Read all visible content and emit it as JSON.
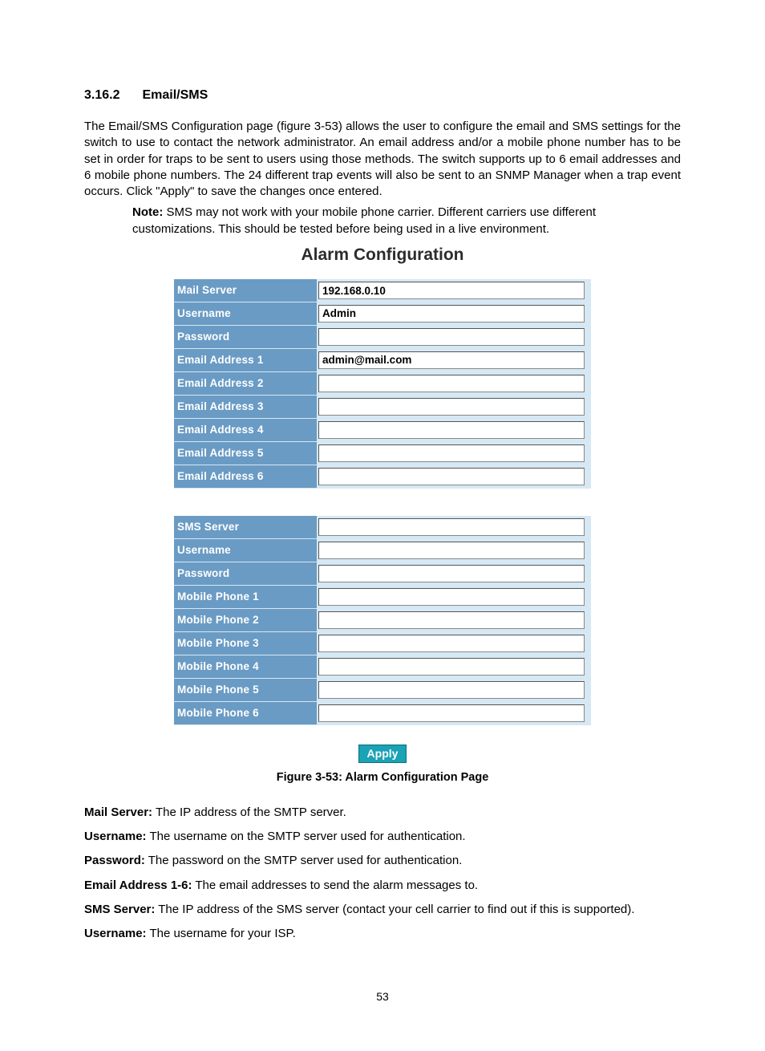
{
  "section": {
    "number": "3.16.2",
    "title": "Email/SMS"
  },
  "intro_paragraph": "The Email/SMS Configuration page (figure 3-53) allows the user to configure the email and SMS settings for the switch to use to contact the network administrator. An email address and/or a mobile phone number has to be set in order for traps to be sent to users using those methods. The switch supports up to 6 email addresses and 6 mobile phone numbers. The 24 different trap events will also be sent to an SNMP Manager when a trap event occurs. Click \"Apply\" to save the changes once entered.",
  "note": {
    "label": "Note:",
    "text": " SMS may not work with your mobile phone carrier. Different carriers use different customizations. This should be tested before being used in a live environment."
  },
  "figure": {
    "heading": "Alarm Configuration",
    "email_rows": [
      {
        "label": "Mail Server",
        "value": "192.168.0.10"
      },
      {
        "label": "Username",
        "value": "Admin"
      },
      {
        "label": "Password",
        "value": ""
      },
      {
        "label": "Email Address 1",
        "value": "admin@mail.com"
      },
      {
        "label": "Email Address 2",
        "value": ""
      },
      {
        "label": "Email Address 3",
        "value": ""
      },
      {
        "label": "Email Address 4",
        "value": ""
      },
      {
        "label": "Email Address 5",
        "value": ""
      },
      {
        "label": "Email Address 6",
        "value": ""
      }
    ],
    "sms_rows": [
      {
        "label": "SMS Server",
        "value": ""
      },
      {
        "label": "Username",
        "value": ""
      },
      {
        "label": "Password",
        "value": ""
      },
      {
        "label": "Mobile Phone 1",
        "value": ""
      },
      {
        "label": "Mobile Phone 2",
        "value": ""
      },
      {
        "label": "Mobile Phone 3",
        "value": ""
      },
      {
        "label": "Mobile Phone 4",
        "value": ""
      },
      {
        "label": "Mobile Phone 5",
        "value": ""
      },
      {
        "label": "Mobile Phone 6",
        "value": ""
      }
    ],
    "apply_label": "Apply",
    "caption": "Figure 3-53: Alarm Configuration Page"
  },
  "definitions": [
    {
      "term": "Mail Server:",
      "desc": " The IP address of the SMTP server."
    },
    {
      "term": "Username:",
      "desc": " The username on the SMTP server used for authentication."
    },
    {
      "term": "Password:",
      "desc": " The password on the SMTP server used for authentication."
    },
    {
      "term": "Email Address 1-6:",
      "desc": " The email addresses to send the alarm messages to."
    },
    {
      "term": "SMS Server:",
      "desc": " The IP address of the SMS server (contact your cell carrier to find out if this is supported)."
    },
    {
      "term": "Username:",
      "desc": " The username for your ISP."
    }
  ],
  "page_number": "53"
}
